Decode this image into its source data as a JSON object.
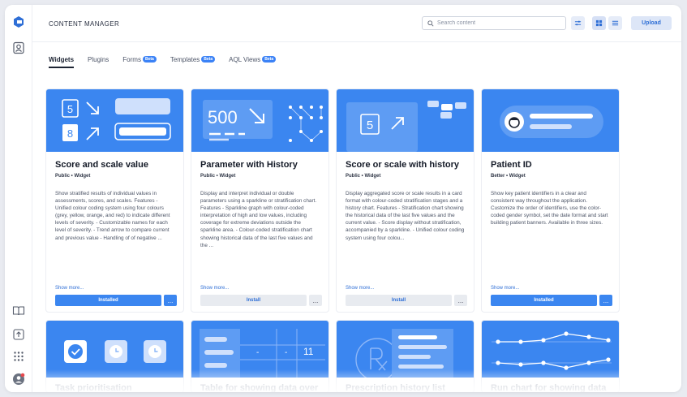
{
  "header": {
    "title": "CONTENT MANAGER",
    "search_placeholder": "Search content",
    "upload_label": "Upload"
  },
  "tabs": [
    {
      "label": "Widgets",
      "beta": false,
      "active": true
    },
    {
      "label": "Plugins",
      "beta": false,
      "active": false
    },
    {
      "label": "Forms",
      "beta": true,
      "active": false
    },
    {
      "label": "Templates",
      "beta": true,
      "active": false
    },
    {
      "label": "AQL Views",
      "beta": true,
      "active": false
    }
  ],
  "beta_label": "Beta",
  "cards": [
    {
      "title": "Score and scale value",
      "meta": "Public  •  Widget",
      "description": "Show stratified results of individual values in assessments, scores, and scales. Features - Unified colour coding system using four colours (grey, yellow, orange, and red) to indicate different levels of severity. - Customizable names for each level of severity. - Trend arrow to compare current and previous value - Handling of of negative ...",
      "show_more": "Show more...",
      "action": "Installed",
      "state": "installed",
      "image_text": [
        "5",
        "8"
      ]
    },
    {
      "title": "Parameter with History",
      "meta": "Public  •  Widget",
      "description": "Display and interpret individual or double parameters using a sparkline or stratification chart. Features - Sparkline graph with colour-coded interpretation of high and low values, including coverage for extreme deviations outside the sparkline area. - Colour-coded stratification chart showing historical data of the last five values and the ...",
      "show_more": "Show more...",
      "action": "Install",
      "state": "install",
      "image_text": [
        "500"
      ]
    },
    {
      "title": "Score or scale with history",
      "meta": "Public  •  Widget",
      "description": "Display aggregated score or scale results in a card format with colour-coded stratification stages and a history chart. Features - Stratification chart showing the historical data of the last five values and the current value. - Score display without stratification, accompanied by a sparkline. - Unified colour coding system using four colou...",
      "show_more": "Show more...",
      "action": "Install",
      "state": "install",
      "image_text": [
        "5"
      ]
    },
    {
      "title": "Patient ID",
      "meta": "Better  •  Widget",
      "description": "Show key patient identifiers in a clear and consistent way throughout the application. Customize the order of identifiers, use the color-coded gender symbol, set the date format and start building patient banners. Available in three sizes.",
      "show_more": "Show more...",
      "action": "Installed",
      "state": "installed",
      "image_text": []
    }
  ],
  "cards_row2": [
    {
      "title": "Task prioritisation"
    },
    {
      "title": "Table for showing data over"
    },
    {
      "title": "Prescription history list"
    },
    {
      "title": "Run chart for showing data"
    }
  ],
  "row2_image_text": {
    "table_value": "11",
    "dash": "-"
  },
  "more_glyph": "...",
  "colors": {
    "accent": "#3b86f0",
    "link": "#2f6fd6",
    "upload_bg": "#dde6f7"
  }
}
